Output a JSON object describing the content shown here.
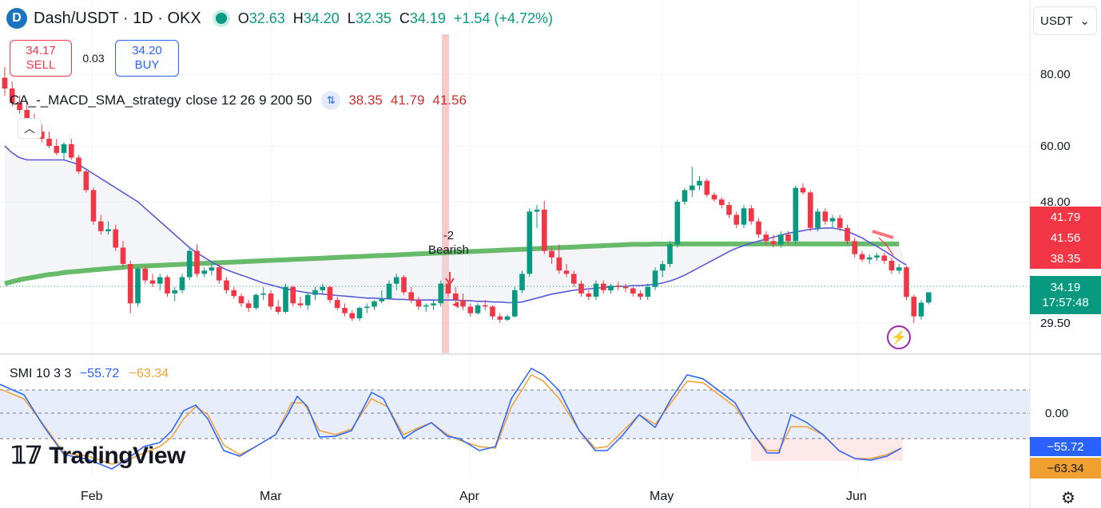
{
  "header": {
    "symbol": "Dash/USDT · 1D · OKX",
    "open_label": "O",
    "open": "32.63",
    "high_label": "H",
    "high": "34.20",
    "low_label": "L",
    "low": "32.35",
    "close_label": "C",
    "close": "34.19",
    "change": "+1.54 (+4.72%)"
  },
  "trade": {
    "sell_price": "34.17",
    "sell_label": "SELL",
    "spread": "0.03",
    "buy_price": "34.20",
    "buy_label": "BUY"
  },
  "currency_select": "USDT",
  "indicator": {
    "name": "CA_-_MACD_SMA_strategy",
    "args": "close 12 26 9 200 50",
    "v1": "38.35",
    "v2": "41.79",
    "v3": "41.56"
  },
  "smi_legend": {
    "name": "SMI 10 3 3",
    "v1": "−55.72",
    "v2": "−63.34"
  },
  "signal": {
    "line1": "-2",
    "line2": "Bearish"
  },
  "price_tags": {
    "t1": "41.79",
    "t2": "41.56",
    "t3": "38.35",
    "cur_price": "34.19",
    "cur_time": "17:57:48",
    "smi1": "−55.72",
    "smi2": "−63.34"
  },
  "brand": "TradingView",
  "colors": {
    "up": "#089981",
    "down": "#f23645",
    "sma200": "#4caf50",
    "sma50_1": "#5b5bd6",
    "smi_blue": "#2962ff",
    "smi_orange": "#f0a030"
  },
  "chart_data": {
    "type": "candlestick",
    "title": "Dash/USDT · 1D · OKX",
    "ylim": [
      29.5,
      80
    ],
    "y_ticks": [
      "80.00",
      "60.00",
      "48.00",
      "29.50"
    ],
    "x_ticks": [
      "Feb",
      "Mar",
      "Apr",
      "May",
      "Jun"
    ],
    "candles": [
      {
        "o": 79,
        "h": 82,
        "l": 74,
        "c": 76
      },
      {
        "o": 76,
        "h": 78,
        "l": 71,
        "c": 72
      },
      {
        "o": 72,
        "h": 74,
        "l": 69,
        "c": 70
      },
      {
        "o": 70,
        "h": 72,
        "l": 67,
        "c": 67.5
      },
      {
        "o": 67.5,
        "h": 69,
        "l": 63.5,
        "c": 64
      },
      {
        "o": 64,
        "h": 66,
        "l": 61,
        "c": 62
      },
      {
        "o": 62,
        "h": 64,
        "l": 59.5,
        "c": 60
      },
      {
        "o": 60,
        "h": 62,
        "l": 58,
        "c": 58.5
      },
      {
        "o": 58.5,
        "h": 61,
        "l": 57,
        "c": 60.5
      },
      {
        "o": 60.5,
        "h": 62,
        "l": 57,
        "c": 57.5
      },
      {
        "o": 57.5,
        "h": 58,
        "l": 54,
        "c": 54.5
      },
      {
        "o": 54.5,
        "h": 55,
        "l": 50,
        "c": 50.5
      },
      {
        "o": 50.5,
        "h": 51,
        "l": 44.5,
        "c": 45
      },
      {
        "o": 45,
        "h": 46,
        "l": 43,
        "c": 43.5
      },
      {
        "o": 43.5,
        "h": 45,
        "l": 43,
        "c": 43.8
      },
      {
        "o": 43.8,
        "h": 44.5,
        "l": 40.5,
        "c": 41
      },
      {
        "o": 41,
        "h": 42,
        "l": 38,
        "c": 38.5
      },
      {
        "o": 38.5,
        "h": 39,
        "l": 31,
        "c": 32.5
      },
      {
        "o": 32.5,
        "h": 38,
        "l": 32,
        "c": 37.8
      },
      {
        "o": 37.8,
        "h": 38.2,
        "l": 35.5,
        "c": 36
      },
      {
        "o": 36,
        "h": 37,
        "l": 35,
        "c": 35.5
      },
      {
        "o": 35.5,
        "h": 37,
        "l": 34.5,
        "c": 36.5
      },
      {
        "o": 36.5,
        "h": 36.8,
        "l": 33.5,
        "c": 34
      },
      {
        "o": 34,
        "h": 35,
        "l": 32.8,
        "c": 34.5
      },
      {
        "o": 34.5,
        "h": 37,
        "l": 34,
        "c": 36.5
      },
      {
        "o": 36.5,
        "h": 41,
        "l": 36,
        "c": 40.5
      },
      {
        "o": 40.5,
        "h": 41.5,
        "l": 36.5,
        "c": 37
      },
      {
        "o": 37,
        "h": 38,
        "l": 36.5,
        "c": 37.5
      },
      {
        "o": 37.5,
        "h": 38.5,
        "l": 36.8,
        "c": 38
      },
      {
        "o": 38,
        "h": 38.5,
        "l": 35.5,
        "c": 36
      },
      {
        "o": 36,
        "h": 36.5,
        "l": 34,
        "c": 34.5
      },
      {
        "o": 34.5,
        "h": 35,
        "l": 33.2,
        "c": 33.6
      },
      {
        "o": 33.6,
        "h": 34,
        "l": 32,
        "c": 32.5
      },
      {
        "o": 32.5,
        "h": 33,
        "l": 31.2,
        "c": 31.8
      },
      {
        "o": 31.8,
        "h": 34,
        "l": 31.5,
        "c": 33.8
      },
      {
        "o": 33.8,
        "h": 35,
        "l": 33,
        "c": 34
      },
      {
        "o": 34,
        "h": 34.5,
        "l": 31.5,
        "c": 32
      },
      {
        "o": 32,
        "h": 33,
        "l": 30.8,
        "c": 31.2
      },
      {
        "o": 31.2,
        "h": 35.5,
        "l": 31,
        "c": 35
      },
      {
        "o": 35,
        "h": 35.2,
        "l": 32,
        "c": 32.5
      },
      {
        "o": 32.5,
        "h": 33.5,
        "l": 31.8,
        "c": 32.2
      },
      {
        "o": 32.2,
        "h": 34,
        "l": 31.5,
        "c": 33.8
      },
      {
        "o": 33.8,
        "h": 35,
        "l": 33,
        "c": 34.5
      },
      {
        "o": 34.5,
        "h": 35.5,
        "l": 34,
        "c": 35
      },
      {
        "o": 35,
        "h": 35.2,
        "l": 32.5,
        "c": 33
      },
      {
        "o": 33,
        "h": 33.5,
        "l": 31.5,
        "c": 31.8
      },
      {
        "o": 31.8,
        "h": 32.5,
        "l": 30.5,
        "c": 31
      },
      {
        "o": 31,
        "h": 31.5,
        "l": 29.8,
        "c": 30.2
      },
      {
        "o": 30.2,
        "h": 32,
        "l": 29.8,
        "c": 31.8
      },
      {
        "o": 31.8,
        "h": 32.5,
        "l": 31,
        "c": 32
      },
      {
        "o": 32,
        "h": 33,
        "l": 31.5,
        "c": 32.8
      },
      {
        "o": 32.8,
        "h": 34.5,
        "l": 32.5,
        "c": 33.2
      },
      {
        "o": 33.2,
        "h": 36,
        "l": 33,
        "c": 35.5
      },
      {
        "o": 35.5,
        "h": 37,
        "l": 34.5,
        "c": 36.5
      },
      {
        "o": 36.5,
        "h": 36.8,
        "l": 33.8,
        "c": 34.2
      },
      {
        "o": 34.2,
        "h": 35,
        "l": 32.5,
        "c": 33
      },
      {
        "o": 33,
        "h": 33.5,
        "l": 31.5,
        "c": 32
      },
      {
        "o": 32,
        "h": 32.5,
        "l": 31.2,
        "c": 32.2
      },
      {
        "o": 32.2,
        "h": 33,
        "l": 31.5,
        "c": 32.5
      },
      {
        "o": 32.5,
        "h": 36,
        "l": 32,
        "c": 35.5
      },
      {
        "o": 35.5,
        "h": 36,
        "l": 33.5,
        "c": 34
      },
      {
        "o": 34,
        "h": 35,
        "l": 32.5,
        "c": 33
      },
      {
        "o": 33,
        "h": 34,
        "l": 31.5,
        "c": 32
      },
      {
        "o": 32,
        "h": 32.5,
        "l": 30.5,
        "c": 31
      },
      {
        "o": 31,
        "h": 32.5,
        "l": 30.8,
        "c": 32.2
      },
      {
        "o": 32.2,
        "h": 33,
        "l": 31.5,
        "c": 32
      },
      {
        "o": 32,
        "h": 32.2,
        "l": 30,
        "c": 30.5
      },
      {
        "o": 30.5,
        "h": 31,
        "l": 29.5,
        "c": 30
      },
      {
        "o": 30,
        "h": 30.8,
        "l": 29.8,
        "c": 30.5
      },
      {
        "o": 30.5,
        "h": 35,
        "l": 30.3,
        "c": 34.5
      },
      {
        "o": 34.5,
        "h": 37.5,
        "l": 34,
        "c": 37
      },
      {
        "o": 37,
        "h": 47,
        "l": 36.5,
        "c": 46.5
      },
      {
        "o": 46.5,
        "h": 47.5,
        "l": 44,
        "c": 46.8
      },
      {
        "o": 46.8,
        "h": 48.2,
        "l": 40,
        "c": 40.5
      },
      {
        "o": 40.5,
        "h": 41,
        "l": 38.5,
        "c": 39.5
      },
      {
        "o": 39.5,
        "h": 41.5,
        "l": 37,
        "c": 37.5
      },
      {
        "o": 37.5,
        "h": 38.5,
        "l": 36.5,
        "c": 37
      },
      {
        "o": 37,
        "h": 37.5,
        "l": 35,
        "c": 35.5
      },
      {
        "o": 35.5,
        "h": 36,
        "l": 33.5,
        "c": 34
      },
      {
        "o": 34,
        "h": 34.5,
        "l": 33,
        "c": 33.5
      },
      {
        "o": 33.5,
        "h": 36,
        "l": 33,
        "c": 35.5
      },
      {
        "o": 35.5,
        "h": 36,
        "l": 34,
        "c": 34.5
      },
      {
        "o": 34.5,
        "h": 35.5,
        "l": 34,
        "c": 35.2
      },
      {
        "o": 35.2,
        "h": 35.8,
        "l": 34.5,
        "c": 35
      },
      {
        "o": 35,
        "h": 35.5,
        "l": 34.2,
        "c": 34.8
      },
      {
        "o": 34.8,
        "h": 35,
        "l": 33.5,
        "c": 34
      },
      {
        "o": 34,
        "h": 34.5,
        "l": 33,
        "c": 33.5
      },
      {
        "o": 33.5,
        "h": 35.5,
        "l": 33,
        "c": 35
      },
      {
        "o": 35,
        "h": 38,
        "l": 34.5,
        "c": 37.5
      },
      {
        "o": 37.5,
        "h": 39,
        "l": 36.5,
        "c": 38.5
      },
      {
        "o": 38.5,
        "h": 42,
        "l": 38,
        "c": 41.5
      },
      {
        "o": 41.5,
        "h": 48.5,
        "l": 41,
        "c": 48
      },
      {
        "o": 48,
        "h": 51,
        "l": 47.5,
        "c": 50.5
      },
      {
        "o": 50.5,
        "h": 55.5,
        "l": 49,
        "c": 51.5
      },
      {
        "o": 51.5,
        "h": 53.5,
        "l": 50.5,
        "c": 52.5
      },
      {
        "o": 52.5,
        "h": 53,
        "l": 49,
        "c": 49.5
      },
      {
        "o": 49.5,
        "h": 50,
        "l": 48,
        "c": 48.5
      },
      {
        "o": 48.5,
        "h": 49,
        "l": 47,
        "c": 47.5
      },
      {
        "o": 47.5,
        "h": 48,
        "l": 45.5,
        "c": 46
      },
      {
        "o": 46,
        "h": 46.5,
        "l": 44,
        "c": 44.5
      },
      {
        "o": 44.5,
        "h": 47.5,
        "l": 44,
        "c": 47
      },
      {
        "o": 47,
        "h": 47.5,
        "l": 44.5,
        "c": 45
      },
      {
        "o": 45,
        "h": 45.5,
        "l": 42.5,
        "c": 43
      },
      {
        "o": 43,
        "h": 43.5,
        "l": 41.5,
        "c": 42
      },
      {
        "o": 42,
        "h": 43,
        "l": 41,
        "c": 41.5
      },
      {
        "o": 41.5,
        "h": 43.5,
        "l": 41,
        "c": 43
      },
      {
        "o": 43,
        "h": 43.5,
        "l": 41.5,
        "c": 42
      },
      {
        "o": 42,
        "h": 51.5,
        "l": 41.5,
        "c": 51
      },
      {
        "o": 51,
        "h": 52,
        "l": 49.5,
        "c": 50
      },
      {
        "o": 50,
        "h": 50.5,
        "l": 43.5,
        "c": 44
      },
      {
        "o": 44,
        "h": 47,
        "l": 43.5,
        "c": 46.5
      },
      {
        "o": 46.5,
        "h": 47,
        "l": 44.5,
        "c": 45
      },
      {
        "o": 45,
        "h": 46,
        "l": 44,
        "c": 45.5
      },
      {
        "o": 45.5,
        "h": 46,
        "l": 43.5,
        "c": 44
      },
      {
        "o": 44,
        "h": 44.5,
        "l": 41.5,
        "c": 42
      },
      {
        "o": 42,
        "h": 42.5,
        "l": 39.5,
        "c": 40
      },
      {
        "o": 40,
        "h": 40.5,
        "l": 38.8,
        "c": 39.2
      },
      {
        "o": 39.2,
        "h": 40,
        "l": 38.5,
        "c": 39.5
      },
      {
        "o": 39.5,
        "h": 40.2,
        "l": 39,
        "c": 39.8
      },
      {
        "o": 39.8,
        "h": 40.2,
        "l": 38.5,
        "c": 39
      },
      {
        "o": 39,
        "h": 39.5,
        "l": 37,
        "c": 37.5
      },
      {
        "o": 37.5,
        "h": 38.5,
        "l": 37,
        "c": 38
      },
      {
        "o": 38,
        "h": 38.2,
        "l": 33,
        "c": 33.5
      },
      {
        "o": 33.5,
        "h": 33.8,
        "l": 29.5,
        "c": 30.5
      },
      {
        "o": 30.5,
        "h": 33,
        "l": 30,
        "c": 32.6
      },
      {
        "o": 32.63,
        "h": 34.2,
        "l": 32.35,
        "c": 34.19
      }
    ],
    "sma200": [
      35.5,
      35.8,
      36.1,
      36.3,
      36.5,
      36.7,
      36.9,
      37.0,
      37.2,
      37.3,
      37.4,
      37.5,
      37.6,
      37.7,
      37.8,
      37.9,
      38.0,
      38.1,
      38.15,
      38.2,
      38.25,
      38.3,
      38.35,
      38.4,
      38.45,
      38.5,
      38.55,
      38.6,
      38.65,
      38.7,
      38.75,
      38.8,
      38.85,
      38.9,
      38.95,
      39.0,
      39.05,
      39.1,
      39.15,
      39.2,
      39.25,
      39.3,
      39.35,
      39.4,
      39.45,
      39.5,
      39.55,
      39.6,
      39.65,
      39.7,
      39.75,
      39.8,
      39.85,
      39.9,
      39.95,
      40.0,
      40.05,
      40.1,
      40.15,
      40.2,
      40.25,
      40.3,
      40.35,
      40.4,
      40.45,
      40.5,
      40.55,
      40.6,
      40.65,
      40.7,
      40.75,
      40.8,
      40.85,
      40.9,
      40.95,
      41.0,
      41.05,
      41.1,
      41.15,
      41.2,
      41.25,
      41.3,
      41.35,
      41.4,
      41.45,
      41.5,
      41.5,
      41.5,
      41.55,
      41.55,
      41.55,
      41.56,
      41.56,
      41.56,
      41.56,
      41.56,
      41.56,
      41.56,
      41.56,
      41.56,
      41.56,
      41.56,
      41.56,
      41.56,
      41.56,
      41.56,
      41.56,
      41.56,
      41.56,
      41.56,
      41.56,
      41.56,
      41.56,
      41.56,
      41.56,
      41.56,
      41.56,
      41.56,
      41.56,
      41.56,
      41.56,
      41.56
    ],
    "sma50": [
      60,
      58.5,
      57.5,
      57,
      57,
      57,
      57,
      57,
      57,
      56.5,
      56,
      55,
      54,
      53,
      52,
      51,
      50,
      49,
      48,
      47,
      46,
      45,
      44,
      43,
      42,
      41,
      40.2,
      39.5,
      38.8,
      38.2,
      37.6,
      37.2,
      36.8,
      36.4,
      36.0,
      35.6,
      35.3,
      35.0,
      34.7,
      34.5,
      34.3,
      34.1,
      34.0,
      33.9,
      33.8,
      33.7,
      33.6,
      33.5,
      33.4,
      33.3,
      33.3,
      33.2,
      33.2,
      33.1,
      33.1,
      33.0,
      33.0,
      33.0,
      33.0,
      33.0,
      33.0,
      33.0,
      32.9,
      32.9,
      32.8,
      32.8,
      32.7,
      32.7,
      32.6,
      32.6,
      32.7,
      33.0,
      33.3,
      33.6,
      33.9,
      34.1,
      34.3,
      34.5,
      34.6,
      34.7,
      34.8,
      34.9,
      35.0,
      35.1,
      35.1,
      35.2,
      35.2,
      35.3,
      35.4,
      35.6,
      35.9,
      36.3,
      36.8,
      37.4,
      38.0,
      38.6,
      39.2,
      39.8,
      40.4,
      40.9,
      41.3,
      41.7,
      42.0,
      42.3,
      42.6,
      42.9,
      43.2,
      43.4,
      43.6,
      43.8,
      43.9,
      44.0,
      44.0,
      43.8,
      43.5,
      43.0,
      42.5,
      41.79,
      41.2,
      40.5,
      39.8,
      39.0,
      38.35
    ]
  }
}
